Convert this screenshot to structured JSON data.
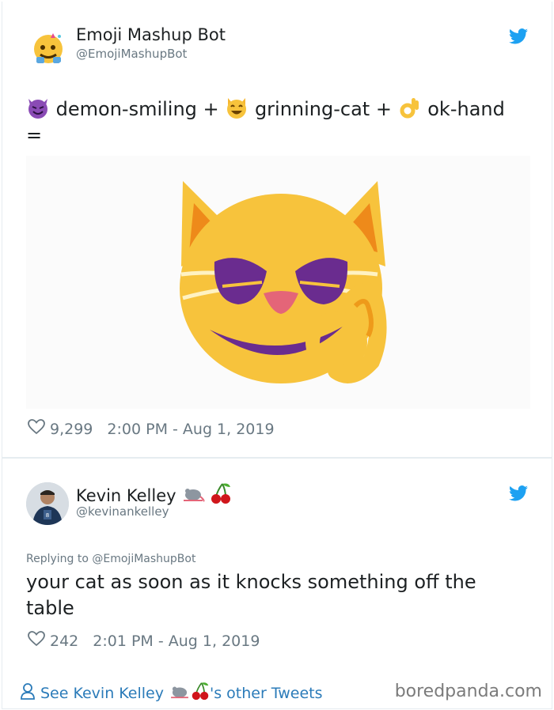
{
  "tweet1": {
    "display_name": "Emoji Mashup Bot",
    "handle": "@EmojiMashupBot",
    "text_part1": "demon-smiling +",
    "text_part2": "grinning-cat +",
    "text_part3": "ok-hand",
    "text_equals": "=",
    "likes": "9,299",
    "timestamp": "2:00 PM - Aug 1, 2019",
    "icons": [
      "demon-smiling-emoji",
      "grinning-cat-emoji",
      "ok-hand-emoji",
      "mashup-cat-image"
    ]
  },
  "tweet2": {
    "display_name": "Kevin Kelley",
    "handle": "@kevinankelley",
    "replying_to": "Replying to @EmojiMashupBot",
    "text": "your cat as soon as it knocks something off the table",
    "likes": "242",
    "timestamp": "2:01 PM - Aug 1, 2019",
    "name_emojis": [
      "mouse-emoji",
      "cherries-emoji"
    ]
  },
  "footer": {
    "see_prefix": "See Kevin Kelley",
    "see_suffix": "'s other Tweets",
    "brand": "boredpanda.com"
  },
  "colors": {
    "twitter_blue": "#1da1f2",
    "link_blue": "#2b7bb9",
    "gray_text": "#697882"
  }
}
